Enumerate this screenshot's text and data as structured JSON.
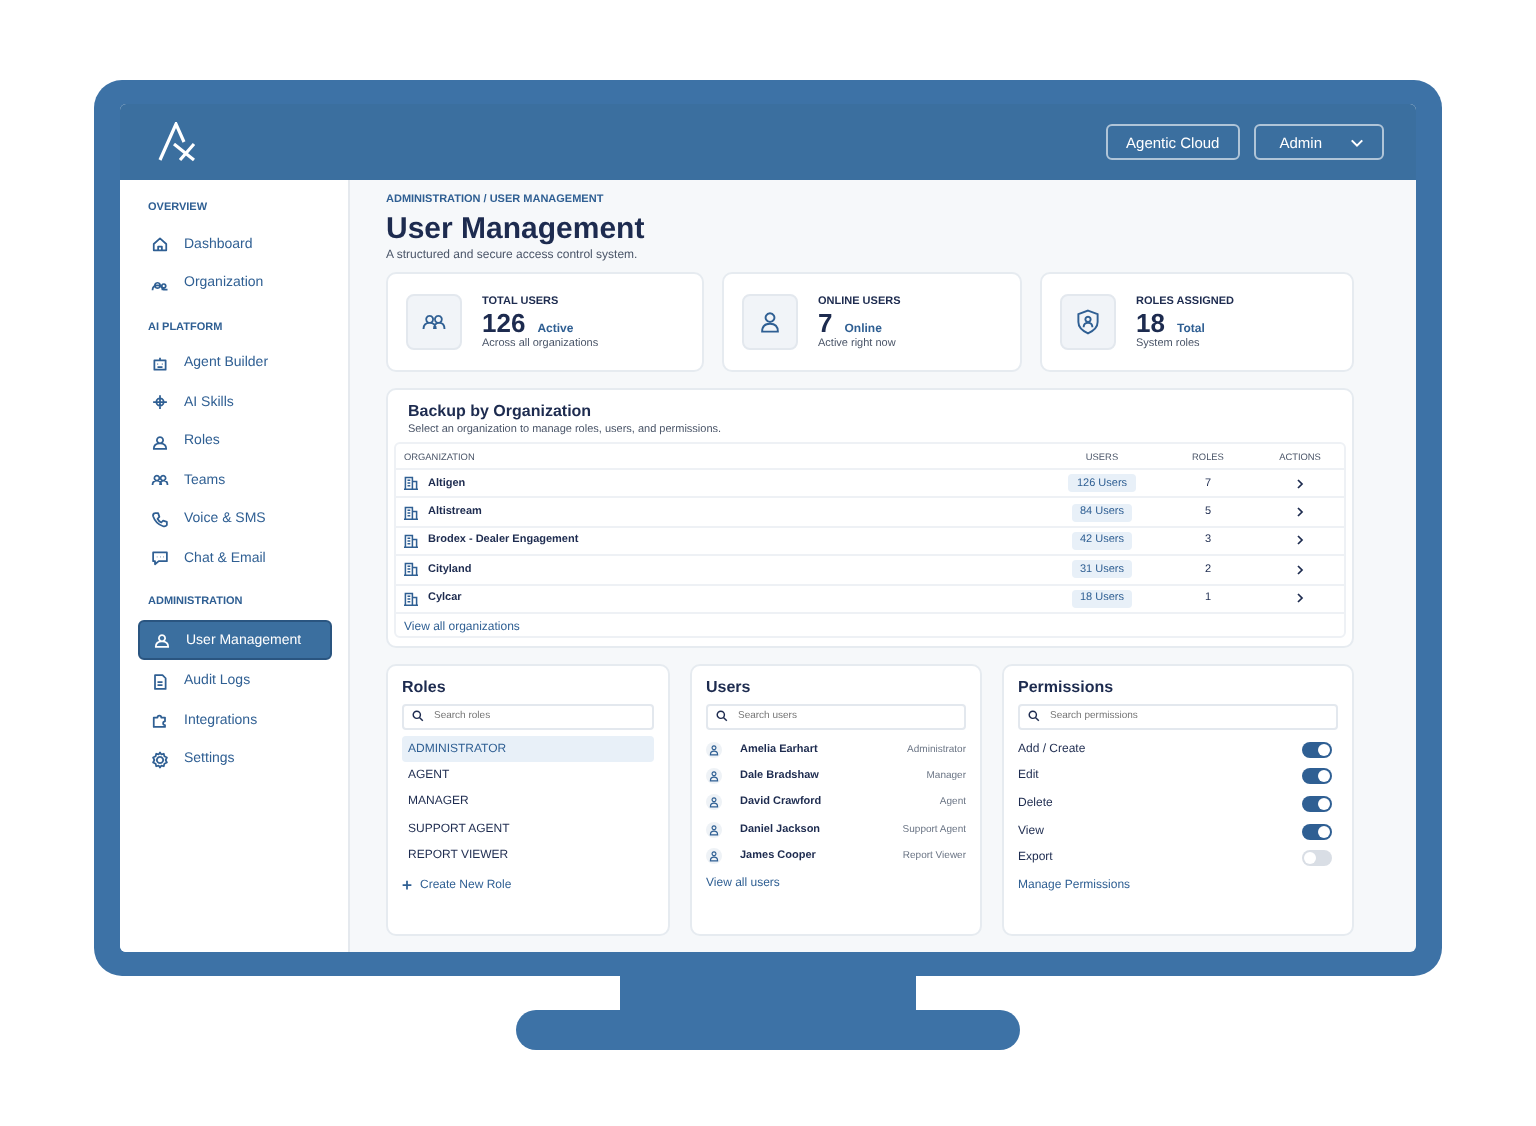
{
  "header": {
    "cloud_button": "Agentic Cloud",
    "account_menu": "Admin"
  },
  "sidebar": {
    "sections": [
      {
        "title": "OVERVIEW",
        "items": [
          {
            "label": "Dashboard",
            "selected": false
          },
          {
            "label": "Organization",
            "selected": false
          }
        ]
      },
      {
        "title": "AI PLATFORM",
        "items": [
          {
            "label": "Agent Builder",
            "selected": false
          },
          {
            "label": "AI Skills",
            "selected": false
          },
          {
            "label": "Roles",
            "selected": false
          },
          {
            "label": "Teams",
            "selected": false
          },
          {
            "label": "Voice & SMS",
            "selected": false
          },
          {
            "label": "Chat & Email",
            "selected": false
          }
        ]
      },
      {
        "title": "ADMINISTRATION",
        "items": [
          {
            "label": "User Management",
            "selected": true
          },
          {
            "label": "Audit Logs",
            "selected": false
          },
          {
            "label": "Integrations",
            "selected": false
          },
          {
            "label": "Settings",
            "selected": false
          }
        ]
      }
    ]
  },
  "breadcrumb": "ADMINISTRATION / USER MANAGEMENT",
  "title": "User Management",
  "subtitle": "A structured and secure access control system.",
  "stats": [
    {
      "label": "TOTAL USERS",
      "value": "126",
      "unit": "Active",
      "caption": "Across all organizations"
    },
    {
      "label": "ONLINE USERS",
      "value": "7",
      "unit": "Online",
      "caption": "Active right now"
    },
    {
      "label": "ROLES ASSIGNED",
      "value": "18",
      "unit": "Total",
      "caption": "System roles"
    }
  ],
  "organizations": {
    "title": "Backup by Organization",
    "subtitle": "Select an organization to manage roles, users, and permissions.",
    "columns": [
      "ORGANIZATION",
      "USERS",
      "ROLES",
      "ACTIONS"
    ],
    "rows": [
      {
        "organization": "Altigen",
        "users": "126 Users",
        "roles": "7"
      },
      {
        "organization": "Altistream",
        "users": "84 Users",
        "roles": "5"
      },
      {
        "organization": "Brodex - Dealer Engagement",
        "users": "42 Users",
        "roles": "3"
      },
      {
        "organization": "Cityland",
        "users": "31 Users",
        "roles": "2"
      },
      {
        "organization": "Cylcar",
        "users": "18 Users",
        "roles": "1"
      }
    ],
    "link": "View all organizations"
  },
  "roles": {
    "title": "Roles",
    "search": {
      "placeholder": "Search roles"
    },
    "items": [
      {
        "label": "ADMINISTRATOR",
        "selected": true
      },
      {
        "label": "AGENT",
        "selected": false
      },
      {
        "label": "MANAGER",
        "selected": false
      },
      {
        "label": "SUPPORT AGENT",
        "selected": false
      },
      {
        "label": "REPORT VIEWER",
        "selected": false
      }
    ],
    "action": "Create New Role"
  },
  "users": {
    "title": "Users",
    "search": {
      "placeholder": "Search users"
    },
    "items": [
      {
        "name": "Amelia Earhart",
        "role": "Administrator"
      },
      {
        "name": "Dale Bradshaw",
        "role": "Manager"
      },
      {
        "name": "David Crawford",
        "role": "Agent"
      },
      {
        "name": "Daniel Jackson",
        "role": "Support Agent"
      },
      {
        "name": "James Cooper",
        "role": "Report Viewer"
      }
    ],
    "link": "View all users"
  },
  "permissions": {
    "title": "Permissions",
    "search": {
      "placeholder": "Search permissions"
    },
    "items": [
      {
        "label": "Add / Create",
        "on": true
      },
      {
        "label": "Edit",
        "on": true
      },
      {
        "label": "Delete",
        "on": true
      },
      {
        "label": "View",
        "on": true
      },
      {
        "label": "Export",
        "on": false
      }
    ],
    "link": "Manage Permissions"
  }
}
